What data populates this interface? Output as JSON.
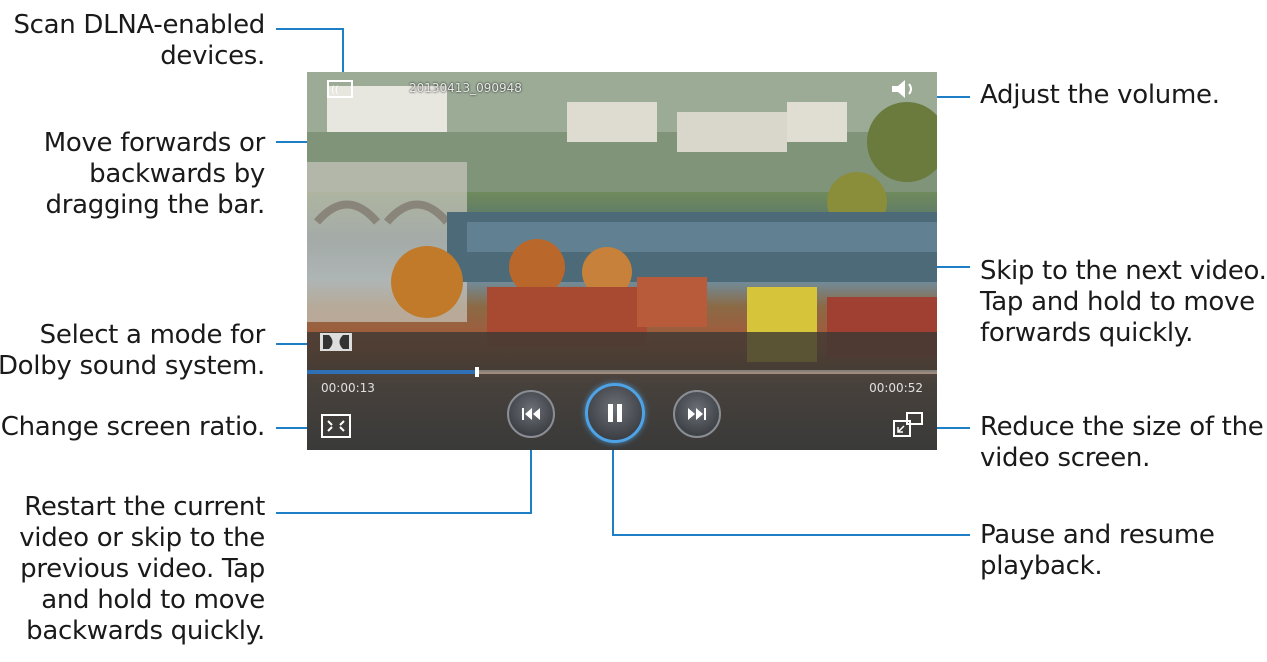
{
  "video": {
    "filename": "20130413_090948",
    "elapsed_time": "00:00:13",
    "total_time": "00:00:52",
    "progress_fraction": 0.27
  },
  "icons": {
    "dlna": "dlna-scan-icon",
    "volume": "volume-icon",
    "dolby": "dolby-icon",
    "screen_ratio": "screen-ratio-icon",
    "previous": "rewind-previous-icon",
    "pause": "pause-icon",
    "next": "fast-forward-next-icon",
    "popup": "popup-player-icon"
  },
  "colors": {
    "callout_line": "#1f7fc6",
    "progress": "#2f6fb5",
    "play_ring": "#4ea3e6"
  },
  "callouts": {
    "dlna": [
      "Scan DLNA-enabled",
      "devices."
    ],
    "seek": [
      "Move forwards or",
      "backwards by",
      "dragging the bar."
    ],
    "dolby": [
      "Select a mode for",
      "Dolby sound system."
    ],
    "ratio": [
      "Change screen ratio."
    ],
    "previous": [
      "Restart the current",
      "video or skip to the",
      "previous video. Tap",
      "and hold to move",
      "backwards quickly."
    ],
    "volume": [
      "Adjust the volume."
    ],
    "next": [
      "Skip to the next video.",
      "Tap and hold to move",
      "forwards quickly."
    ],
    "popup": [
      "Reduce the size of the",
      "video screen."
    ],
    "pause": [
      "Pause and resume",
      "playback."
    ]
  }
}
